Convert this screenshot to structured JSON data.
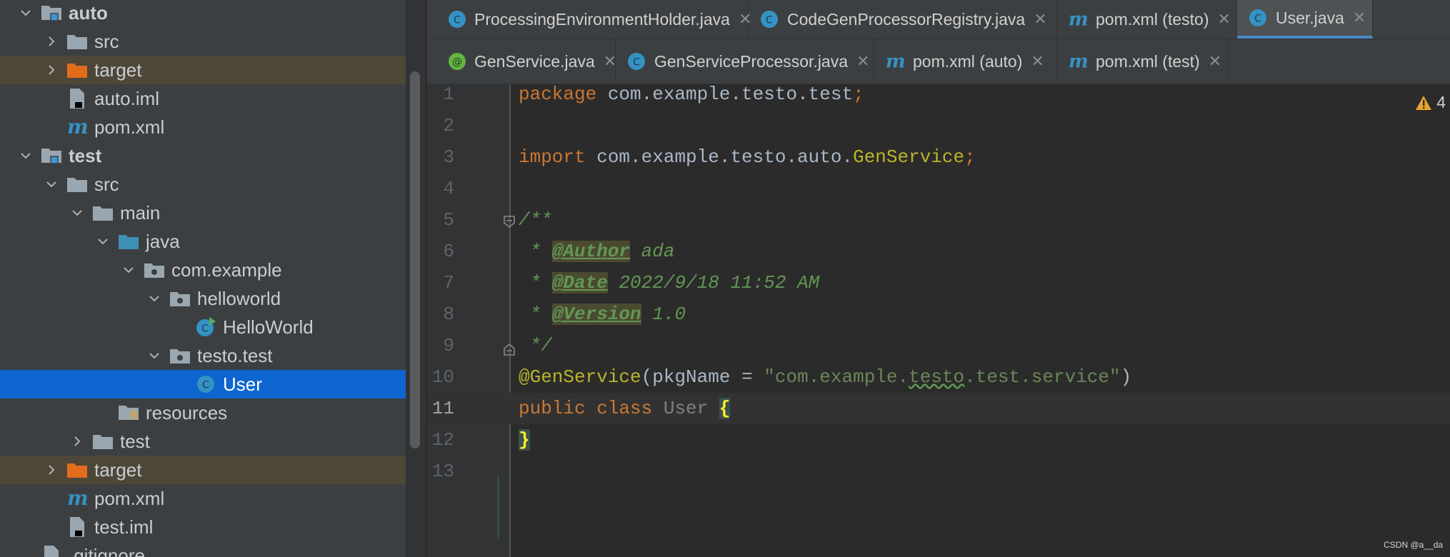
{
  "project_tree": {
    "rows": [
      {
        "label": "auto",
        "depth": 1,
        "chevron": "down",
        "icon": "module-folder-icon",
        "bold": true
      },
      {
        "label": "src",
        "depth": 2,
        "chevron": "right",
        "icon": "folder-icon"
      },
      {
        "label": "target",
        "depth": 2,
        "chevron": "right",
        "icon": "excluded-folder-icon",
        "excluded": true
      },
      {
        "label": "auto.iml",
        "depth": 2,
        "chevron": "none",
        "icon": "iml-file-icon"
      },
      {
        "label": "pom.xml",
        "depth": 2,
        "chevron": "none",
        "icon": "maven-icon"
      },
      {
        "label": "test",
        "depth": 1,
        "chevron": "down",
        "icon": "module-folder-icon",
        "bold": true
      },
      {
        "label": "src",
        "depth": 2,
        "chevron": "down",
        "icon": "folder-icon"
      },
      {
        "label": "main",
        "depth": 3,
        "chevron": "down",
        "icon": "folder-icon"
      },
      {
        "label": "java",
        "depth": 4,
        "chevron": "down",
        "icon": "source-folder-icon"
      },
      {
        "label": "com.example",
        "depth": 5,
        "chevron": "down",
        "icon": "package-icon"
      },
      {
        "label": "helloworld",
        "depth": 6,
        "chevron": "down",
        "icon": "package-icon"
      },
      {
        "label": "HelloWorld",
        "depth": 7,
        "chevron": "none",
        "icon": "runnable-class-icon"
      },
      {
        "label": "testo.test",
        "depth": 6,
        "chevron": "down",
        "icon": "package-icon"
      },
      {
        "label": "User",
        "depth": 7,
        "chevron": "none",
        "icon": "class-icon",
        "selected": true
      },
      {
        "label": "resources",
        "depth": 4,
        "chevron": "none",
        "icon": "resources-folder-icon"
      },
      {
        "label": "test",
        "depth": 3,
        "chevron": "right",
        "icon": "folder-icon"
      },
      {
        "label": "target",
        "depth": 2,
        "chevron": "right",
        "icon": "excluded-folder-icon",
        "excluded": true
      },
      {
        "label": "pom.xml",
        "depth": 2,
        "chevron": "none",
        "icon": "maven-icon"
      },
      {
        "label": "test.iml",
        "depth": 2,
        "chevron": "none",
        "icon": "iml-file-icon"
      },
      {
        "label": ".gitignore",
        "depth": 1,
        "chevron": "none",
        "icon": "text-file-icon"
      }
    ]
  },
  "tabs_row1": [
    {
      "label": "ProcessingEnvironmentHolder.java",
      "icon": "class-icon",
      "active": false
    },
    {
      "label": "CodeGenProcessorRegistry.java",
      "icon": "class-icon",
      "active": false
    },
    {
      "label": "pom.xml (testo)",
      "icon": "maven-icon",
      "active": false
    },
    {
      "label": "User.java",
      "icon": "class-icon",
      "active": true
    }
  ],
  "tabs_row2": [
    {
      "label": "GenService.java",
      "icon": "annotation-icon",
      "active": false
    },
    {
      "label": "GenServiceProcessor.java",
      "icon": "class-icon",
      "active": false
    },
    {
      "label": "pom.xml (auto)",
      "icon": "maven-icon",
      "active": false
    },
    {
      "label": "pom.xml (test)",
      "icon": "maven-icon",
      "active": false
    }
  ],
  "editor": {
    "warning_count": "4",
    "current_line": 11,
    "lines": [
      {
        "n": "1",
        "tokens": [
          [
            "kw",
            "package"
          ],
          [
            "pk",
            " com.example.testo.test"
          ],
          [
            "kw",
            ";"
          ]
        ]
      },
      {
        "n": "2",
        "tokens": []
      },
      {
        "n": "3",
        "tokens": [
          [
            "kw",
            "import"
          ],
          [
            "pk",
            " com.example.testo.auto."
          ],
          [
            "cls",
            "GenService"
          ],
          [
            "kw",
            ";"
          ]
        ]
      },
      {
        "n": "4",
        "tokens": []
      },
      {
        "n": "5",
        "tokens": [
          [
            "cmt",
            "/**"
          ]
        ]
      },
      {
        "n": "6",
        "tokens": [
          [
            "cmt",
            " * "
          ],
          [
            "tag",
            "@Author"
          ],
          [
            "cmt",
            " ada"
          ]
        ]
      },
      {
        "n": "7",
        "tokens": [
          [
            "cmt",
            " * "
          ],
          [
            "tag",
            "@Date"
          ],
          [
            "cmt",
            " 2022/9/18 11:52 AM"
          ]
        ]
      },
      {
        "n": "8",
        "tokens": [
          [
            "cmt",
            " * "
          ],
          [
            "tag",
            "@Version"
          ],
          [
            "cmt",
            " 1.0"
          ]
        ]
      },
      {
        "n": "9",
        "tokens": [
          [
            "cmt",
            " */"
          ]
        ]
      },
      {
        "n": "10",
        "tokens": [
          [
            "ann",
            "@GenService"
          ],
          [
            "pk",
            "(pkgName = "
          ],
          [
            "str",
            "\"com.example."
          ],
          [
            "squig",
            "testo"
          ],
          [
            "str",
            ".test.service\""
          ],
          [
            "pk",
            ")"
          ]
        ]
      },
      {
        "n": "11",
        "tokens": [
          [
            "kw",
            "public class "
          ],
          [
            "clsname",
            "User "
          ],
          [
            "brace",
            "{"
          ]
        ]
      },
      {
        "n": "12",
        "tokens": [
          [
            "brace",
            "}"
          ]
        ]
      },
      {
        "n": "13",
        "tokens": []
      }
    ]
  },
  "watermark": "CSDN @a__da",
  "colors": {
    "selection": "#0d65d0",
    "excluded_bg": "#4e4738",
    "excluded_folder": "#e06c1c",
    "folder": "#9aa7b0",
    "source_folder": "#3d8fb5",
    "class_icon": "#3592c4",
    "maven_icon": "#3592c4",
    "annotation_icon": "#62b543"
  }
}
